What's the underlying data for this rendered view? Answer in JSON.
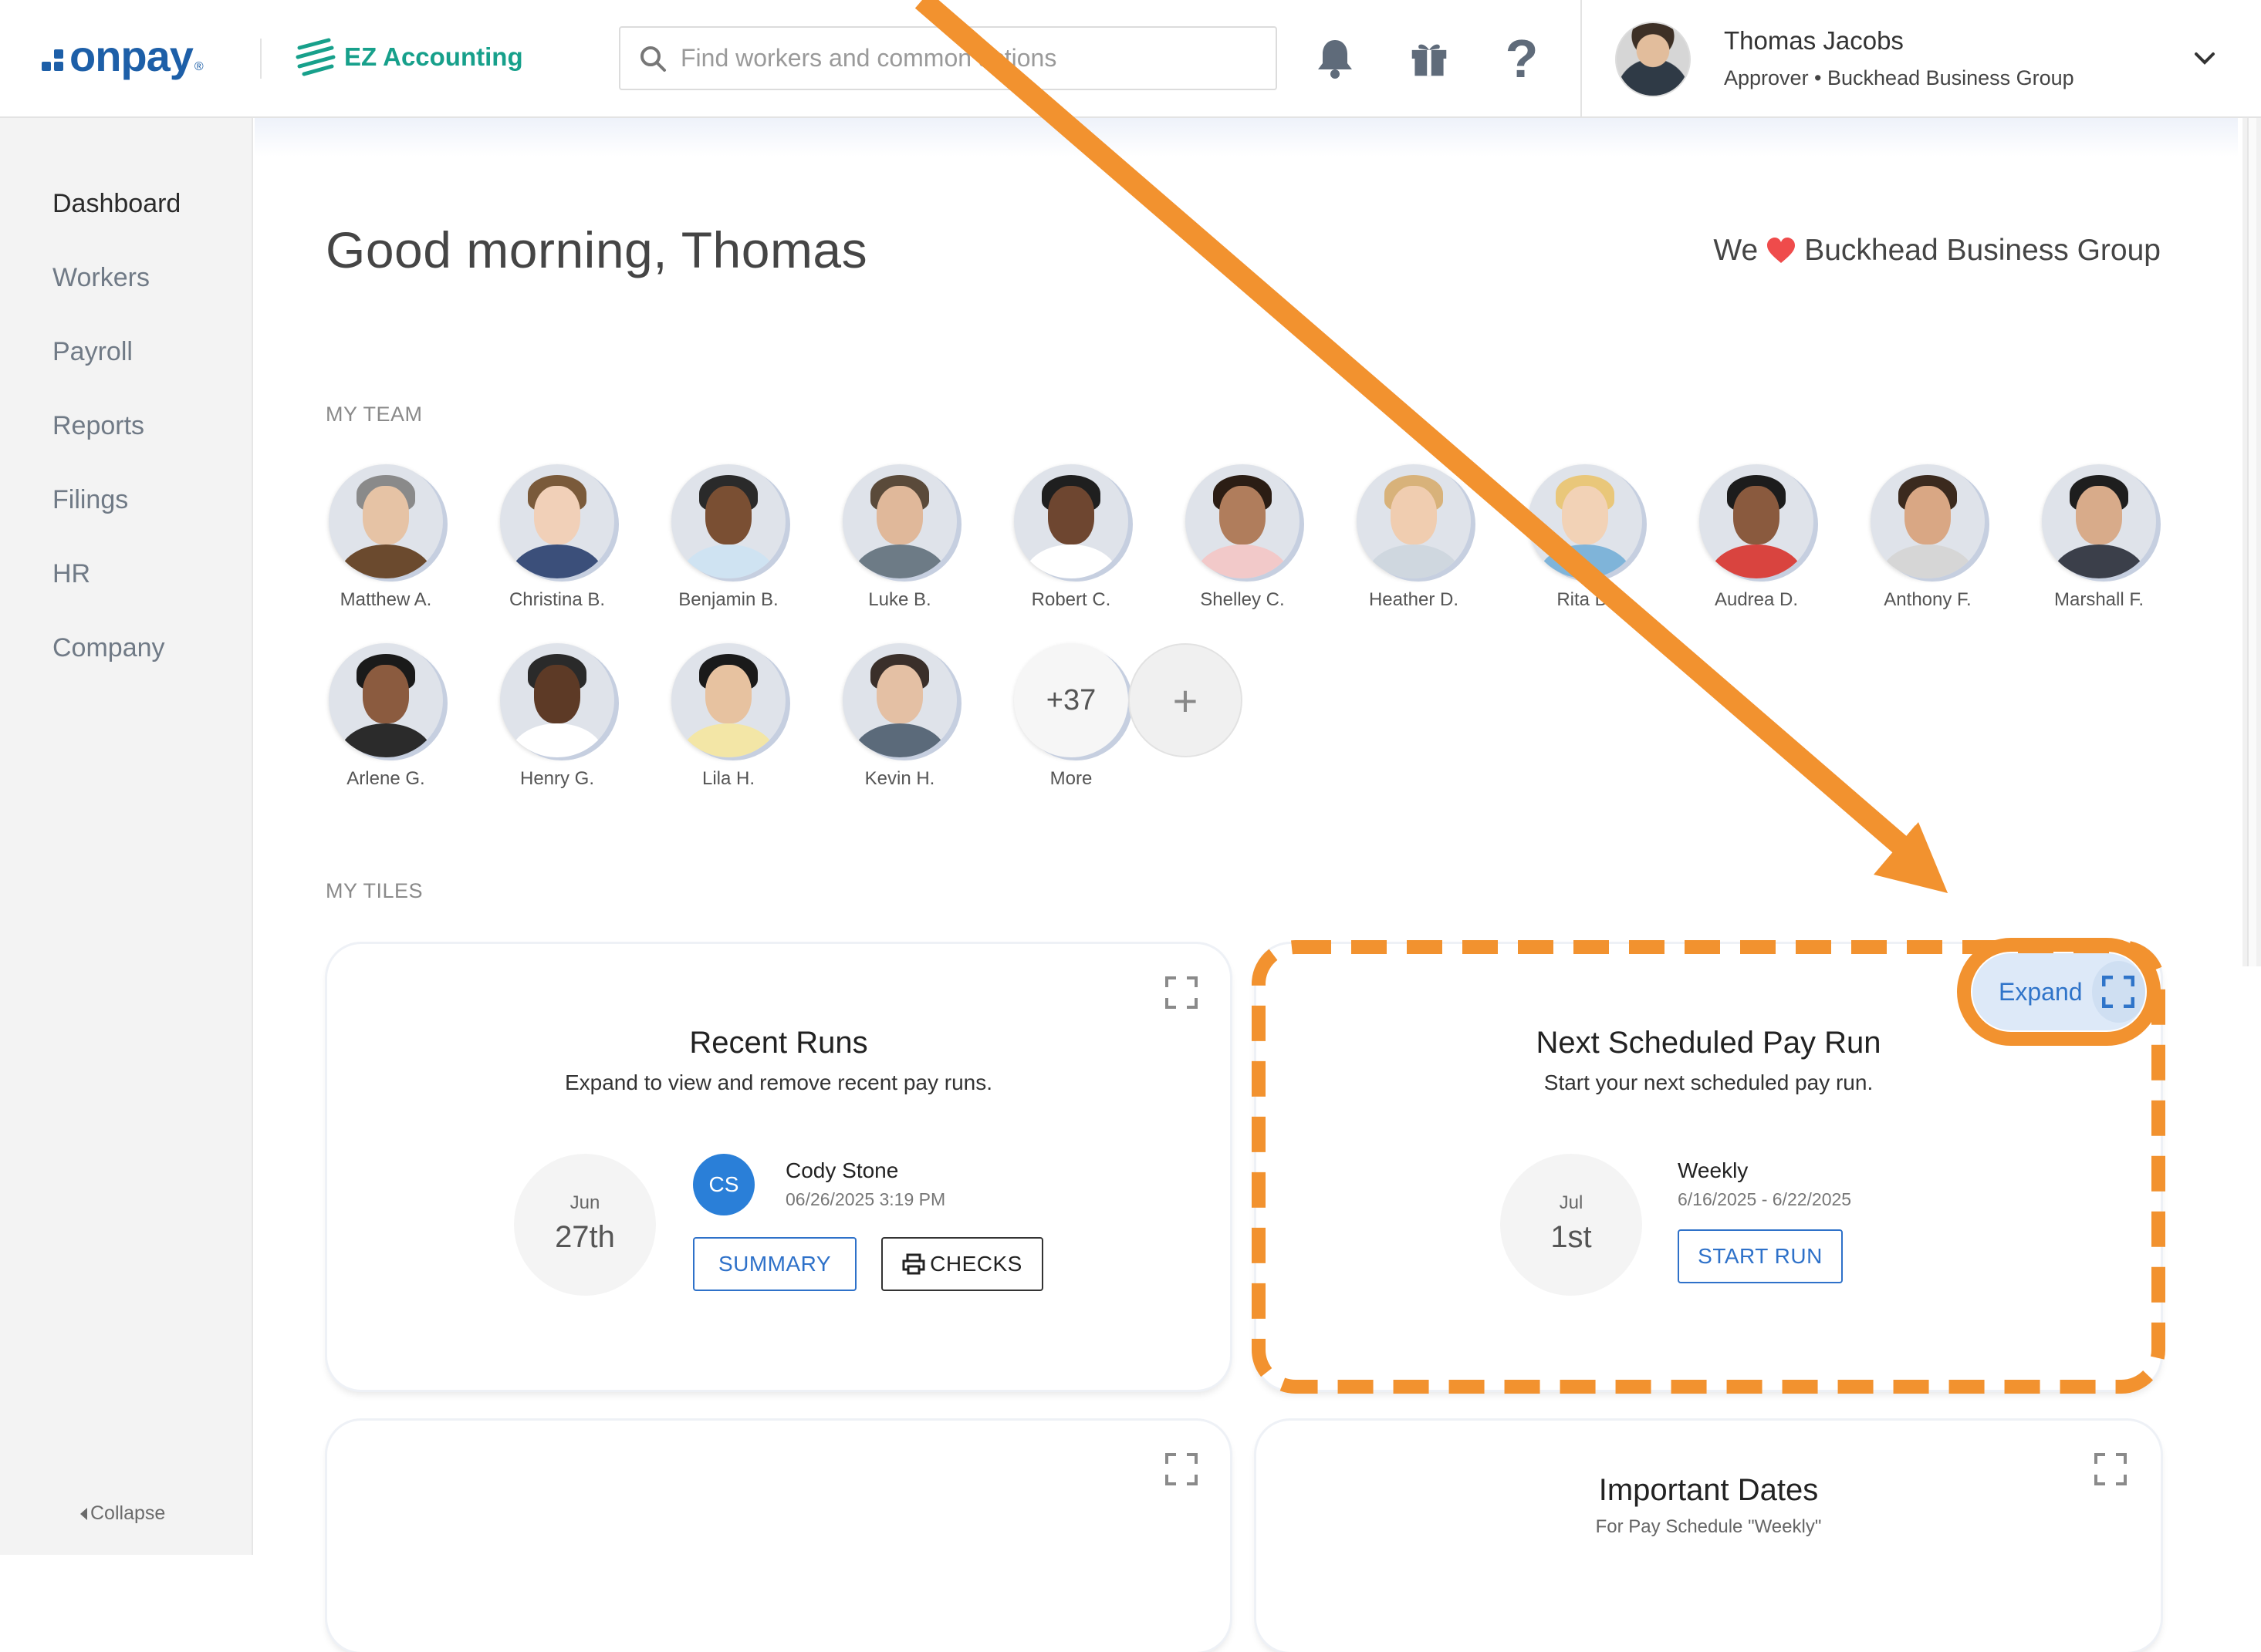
{
  "header": {
    "brand": "onpay",
    "brand_mark": "®",
    "partner": "EZ Accounting",
    "search_placeholder": "Find workers and common actions",
    "icons": [
      "search-icon",
      "bell-icon",
      "gift-icon",
      "help-icon",
      "chevron-down-icon"
    ],
    "help_glyph": "?",
    "user": {
      "name": "Thomas Jacobs",
      "role": "Approver • Buckhead Business Group"
    }
  },
  "sidebar": {
    "items": [
      {
        "label": "Dashboard",
        "active": true
      },
      {
        "label": "Workers"
      },
      {
        "label": "Payroll"
      },
      {
        "label": "Reports"
      },
      {
        "label": "Filings"
      },
      {
        "label": "HR"
      },
      {
        "label": "Company"
      }
    ],
    "collapse_label": "Collapse"
  },
  "main": {
    "greeting": "Good morning, Thomas",
    "we_love_prefix": "We",
    "we_love_company": "Buckhead Business Group",
    "my_team_label": "MY TEAM",
    "team": [
      {
        "name": "Matthew A."
      },
      {
        "name": "Christina B."
      },
      {
        "name": "Benjamin B."
      },
      {
        "name": "Luke B."
      },
      {
        "name": "Robert C."
      },
      {
        "name": "Shelley C."
      },
      {
        "name": "Heather D."
      },
      {
        "name": "Rita D."
      },
      {
        "name": "Audrea D."
      },
      {
        "name": "Anthony F."
      },
      {
        "name": "Marshall F."
      },
      {
        "name": "Arlene G."
      },
      {
        "name": "Henry G."
      },
      {
        "name": "Lila H."
      },
      {
        "name": "Kevin H."
      }
    ],
    "more_count": "+37",
    "more_label": "More",
    "add_glyph": "+",
    "my_tiles_label": "MY TILES",
    "tiles": {
      "recent_runs": {
        "title": "Recent Runs",
        "subtitle": "Expand to view and remove recent pay runs.",
        "month": "Jun",
        "day": "27th",
        "initials": "CS",
        "person": "Cody Stone",
        "timestamp": "06/26/2025 3:19 PM",
        "summary_btn": "SUMMARY",
        "checks_btn": "CHECKS"
      },
      "next_run": {
        "title": "Next Scheduled Pay Run",
        "subtitle": "Start your next scheduled pay run.",
        "month": "Jul",
        "day": "1st",
        "schedule": "Weekly",
        "range": "6/16/2025 - 6/22/2025",
        "start_btn": "START RUN",
        "expand_label": "Expand"
      },
      "important_dates": {
        "title": "Important Dates",
        "subtitle": "For Pay Schedule \"Weekly\""
      }
    }
  },
  "colors": {
    "brand_blue": "#1d5fa8",
    "ez_green": "#17a08b",
    "accent_blue": "#2e71c9",
    "annotation_orange": "#f2922f",
    "heart_red": "#ef4b4b"
  }
}
